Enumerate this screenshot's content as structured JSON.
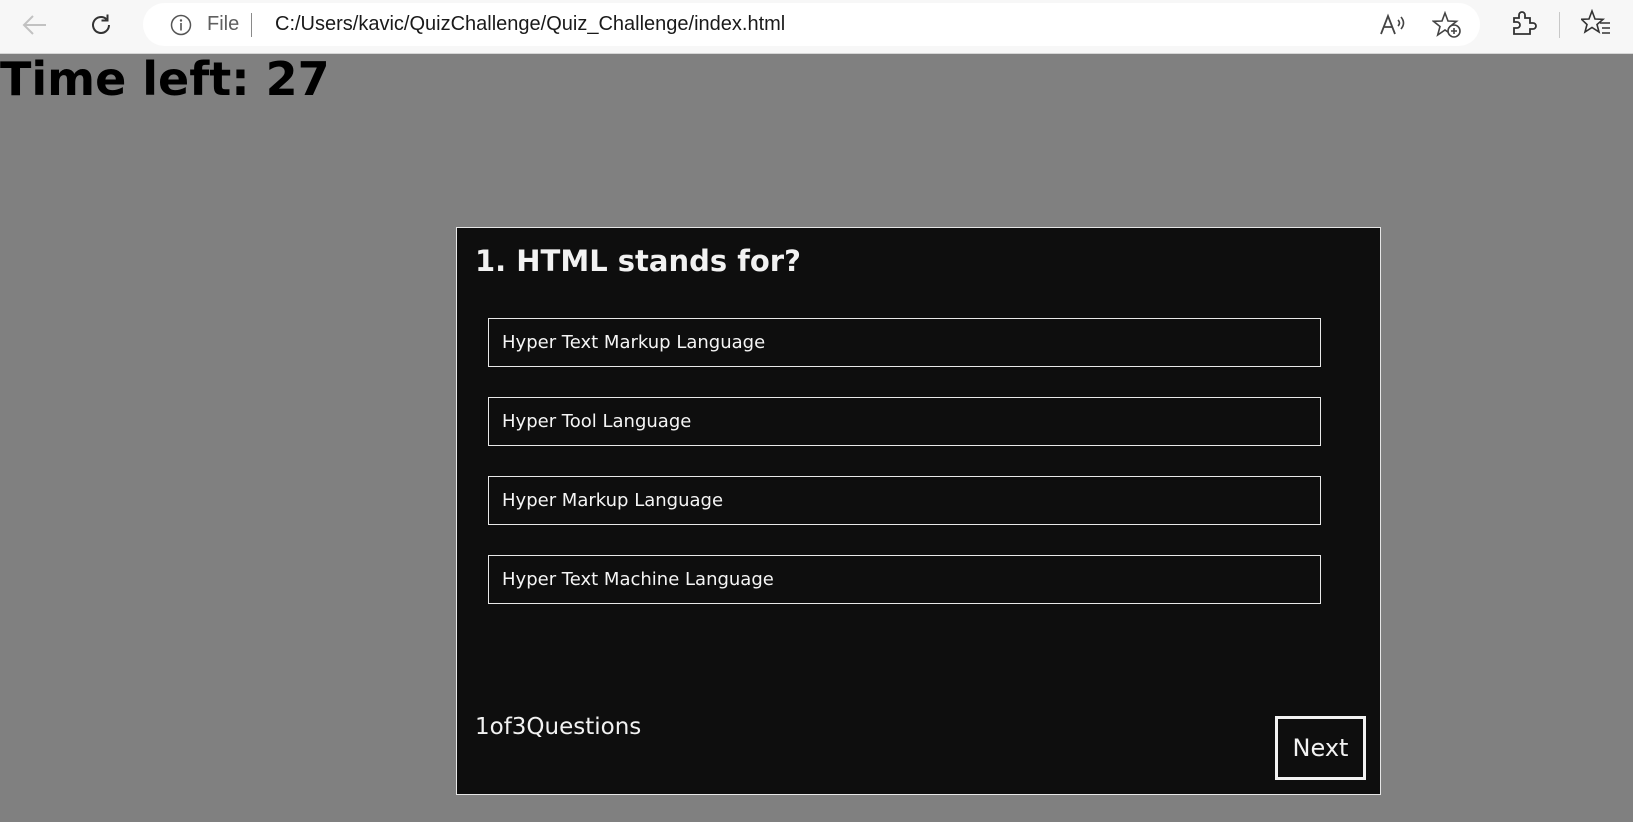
{
  "browser": {
    "file_label": "File",
    "url": "C:/Users/kavic/QuizChallenge/Quiz_Challenge/index.html",
    "icons": [
      "back-arrow-icon",
      "reload-icon",
      "info-icon",
      "read-aloud-icon",
      "add-favorite-icon",
      "extensions-icon",
      "favorites-icon"
    ]
  },
  "timer": {
    "text": "Time left: 27"
  },
  "quiz": {
    "question": "1. HTML stands for?",
    "options": [
      "Hyper Text Markup Language",
      "Hyper Tool Language",
      "Hyper Markup Language",
      "Hyper Text Machine Language"
    ],
    "counter": "1of3Questions",
    "next_label": "Next"
  },
  "colors": {
    "page_background": "#808080",
    "quiz_background": "#0e0e0e",
    "quiz_text": "#f2f2f2"
  }
}
